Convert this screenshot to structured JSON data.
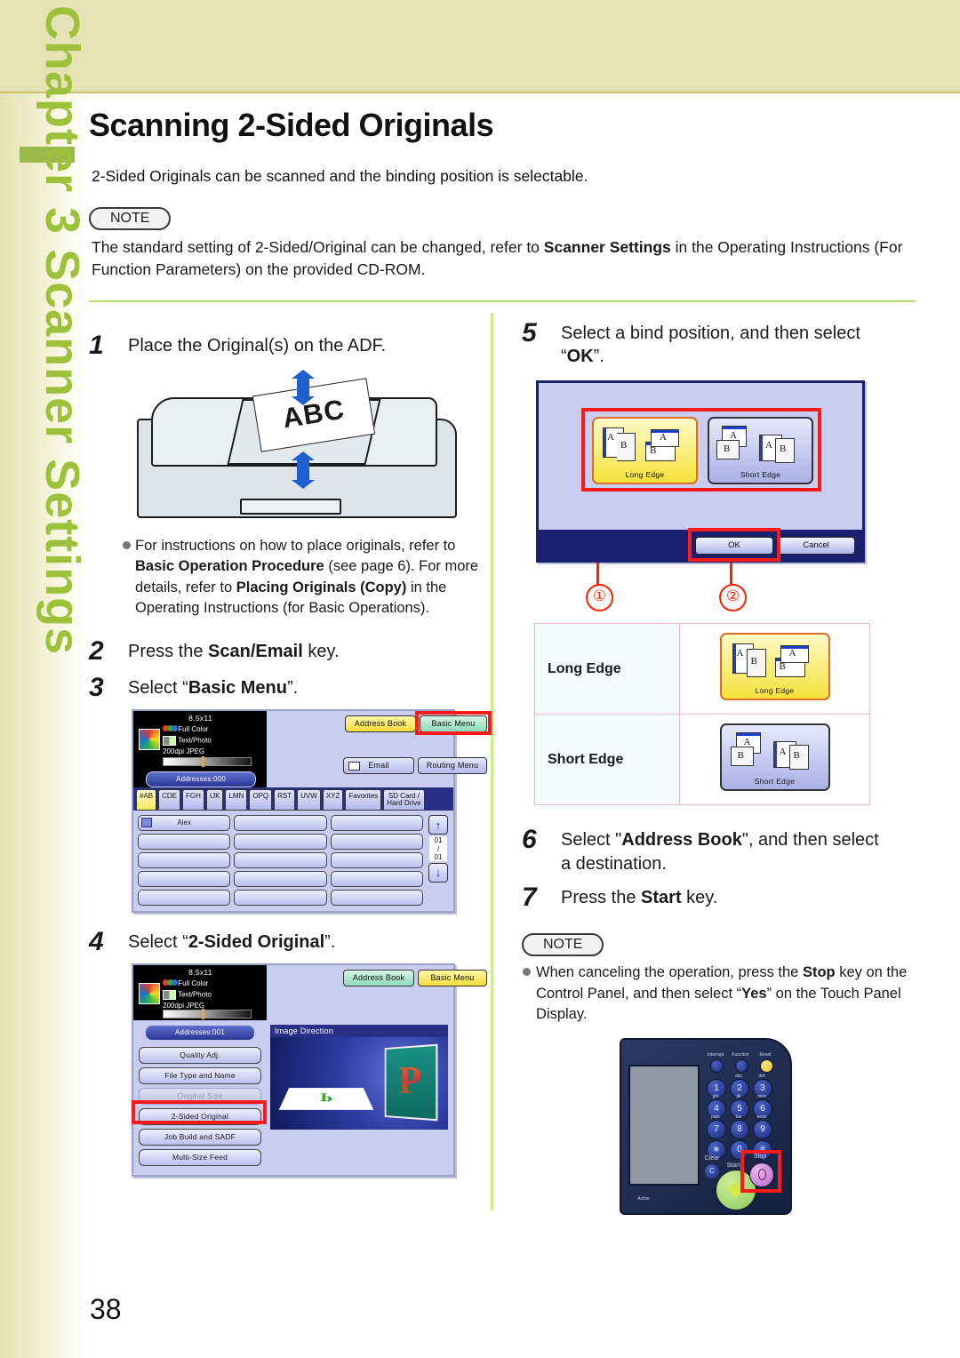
{
  "sidebar": {
    "chapter_text": "Chapter 3   Scanner Settings"
  },
  "page": {
    "number": "38"
  },
  "header": {
    "title": "Scanning 2-Sided Originals",
    "lead": "2-Sided Originals can be scanned and the binding position is selectable.",
    "note_label": "NOTE",
    "note_text_1": "The standard setting of 2-Sided/Original can be changed, refer to ",
    "note_bold_1": "Scanner Settings",
    "note_text_2": " in the Operating Instructions (For Function Parameters) on the provided CD-ROM."
  },
  "steps": {
    "s1": {
      "num": "1",
      "text": "Place the Original(s) on the ADF."
    },
    "s2": {
      "num": "2",
      "t1": "Press the ",
      "b1": "Scan/Email",
      "t2": " key."
    },
    "s3": {
      "num": "3",
      "t1": "Select “",
      "b1": "Basic Menu",
      "t2": "”."
    },
    "s4": {
      "num": "4",
      "t1": "Select “",
      "b1": "2-Sided Original",
      "t2": "”."
    },
    "s5": {
      "num": "5",
      "t1": "Select a bind position, and then select “",
      "b1": "OK",
      "t2": "”."
    },
    "s6": {
      "num": "6",
      "t1": "Select \"",
      "b1": "Address Book",
      "t2": "\", and then select a destination."
    },
    "s7": {
      "num": "7",
      "t1": "Press the ",
      "b1": "Start",
      "t2": " key."
    }
  },
  "bullet1": {
    "t1": "For instructions on how to place originals, refer to ",
    "b1": "Basic Operation Procedure",
    "t2": " (see page 6). For more details, refer to ",
    "b2": "Placing Originals (Copy)",
    "t3": " in the Operating Instructions (for Basic Operations)."
  },
  "note2": {
    "label": "NOTE",
    "t1": "When canceling the operation, press the ",
    "b1": "Stop",
    "t2": " key on the Control Panel, and then select “",
    "b2": "Yes",
    "t3": "” on the Touch Panel Display."
  },
  "adf": {
    "paper_text": "ABC"
  },
  "lcd_status": {
    "size": "8.5x11",
    "color_mode": "Full Color",
    "quality": "Text/Photo",
    "resolution": "200dpi JPEG",
    "addresses_000": "Addresses:000",
    "addresses_001": "Addresses:001"
  },
  "lcd_step3": {
    "address_book": "Address Book",
    "basic_menu": "Basic Menu",
    "email": "Email",
    "routing_menu": "Routing Menu",
    "tabs": [
      "#AB",
      "CDE",
      "FGH",
      "IJK",
      "LMN",
      "OPQ",
      "RST",
      "UVW",
      "XYZ",
      "Favorites",
      "SD Card /\nHard Drive"
    ],
    "selected_tab": "#AB",
    "first_entry": "Alex",
    "page_current": "01",
    "page_sep": "/",
    "page_total": "01",
    "up_arrow": "↑",
    "down_arrow": "↓"
  },
  "lcd_step4": {
    "address_book": "Address Book",
    "basic_menu": "Basic Menu",
    "preview_title": "Image Direction",
    "preview_letter": "P",
    "menu": [
      {
        "label": "Quality Adj.",
        "state": "normal"
      },
      {
        "label": "File Type and Name",
        "state": "normal"
      },
      {
        "label": "Original Size",
        "state": "disabled"
      },
      {
        "label": "2-Sided Original",
        "state": "highlighted"
      },
      {
        "label": "Job Build and SADF",
        "state": "normal"
      },
      {
        "label": "Multi-Size Feed",
        "state": "normal"
      }
    ]
  },
  "dialog": {
    "long_edge": "Long Edge",
    "short_edge": "Short Edge",
    "ok": "OK",
    "cancel": "Cancel",
    "callout_1": "①",
    "callout_2": "②",
    "page_a": "A",
    "page_b": "B"
  },
  "edge_table": {
    "rows": [
      {
        "label": "Long Edge",
        "button_caption": "Long Edge",
        "selected": true
      },
      {
        "label": "Short Edge",
        "button_caption": "Short Edge",
        "selected": false
      }
    ]
  },
  "control_panel": {
    "interrupt": "Interrupt",
    "function": "Function",
    "reset": "Reset",
    "keys": [
      "1",
      "2",
      "3",
      "4",
      "5",
      "6",
      "7",
      "8",
      "9",
      "∗",
      "0",
      "#"
    ],
    "key_subs": [
      "",
      "abc",
      "def",
      "ghi",
      "jkl",
      "mno",
      "pqrs",
      "tuv",
      "wxyz"
    ],
    "clear": "Clear",
    "clear_c": "C",
    "start": "Start",
    "stop": "Stop",
    "active": "Active"
  },
  "colors": {
    "band": "#e5e3b6",
    "sidebar_green": "#9ec13c",
    "rule_green": "#b8dd6b",
    "highlight_red": "#ff1a1a",
    "lcd_blue": "#c9cdef",
    "dialog_navy": "#1a1f6e"
  }
}
